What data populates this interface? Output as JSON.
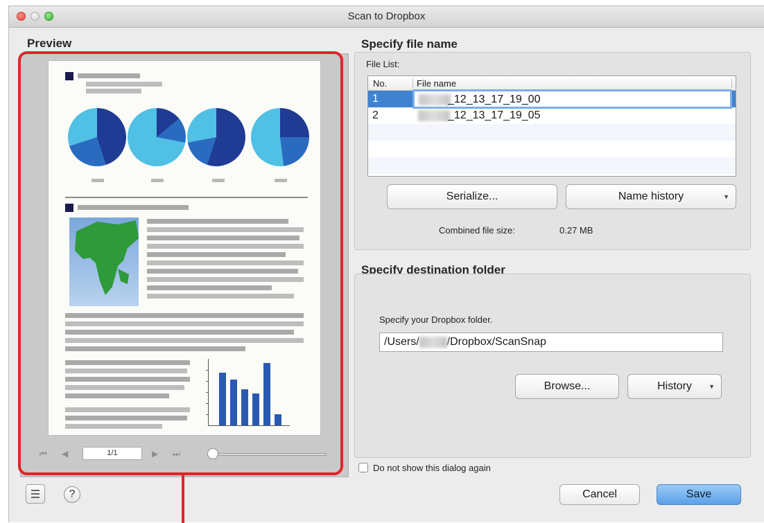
{
  "window": {
    "title": "Scan to Dropbox"
  },
  "preview": {
    "label": "Preview",
    "page_indicator": "1/1",
    "zoom_level": 0,
    "nav_icons": [
      "first-page-icon",
      "previous-page-icon",
      "next-page-icon",
      "last-page-icon"
    ]
  },
  "file_name": {
    "section_label": "Specify file name",
    "list_label": "File List:",
    "columns": [
      "No.",
      "File name"
    ],
    "rows": [
      {
        "no": "1",
        "file_name": "_12_13_17_19_00",
        "selected": true
      },
      {
        "no": "2",
        "file_name": "_12_13_17_19_05",
        "selected": false
      }
    ],
    "serialize_button": "Serialize...",
    "name_history_button": "Name history",
    "combined_size_label": "Combined file size:",
    "combined_size_value": "0.27  MB"
  },
  "destination": {
    "section_label": "Specify destination folder",
    "prompt": "Specify your Dropbox folder.",
    "path_prefix": "/Users/",
    "path_suffix": "/Dropbox/ScanSnap",
    "browse_button": "Browse...",
    "history_button": "History"
  },
  "footer": {
    "checkbox_label": "Do not show this dialog again",
    "checkbox_checked": false,
    "help_icon": "?",
    "cancel_button": "Cancel",
    "save_button": "Save"
  },
  "colors": {
    "highlight": "#e1252a",
    "selection": "#3f83d0",
    "default_button": "#5aa0ea"
  }
}
